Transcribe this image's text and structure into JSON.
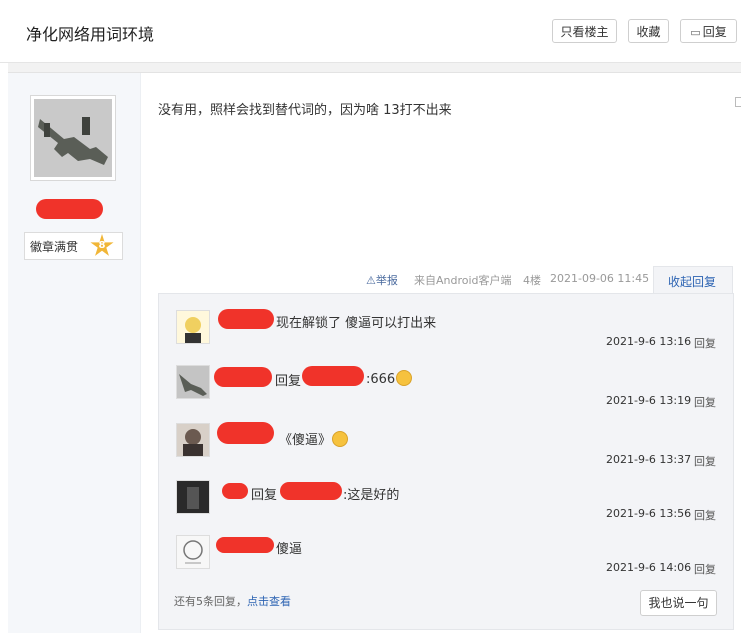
{
  "header": {
    "title": "净化网络用词环境",
    "only_author": "只看楼主",
    "favorite": "收藏",
    "reply": "回复",
    "reply_icon": "speech-bubble-icon"
  },
  "user": {
    "badge_label": "徽章满贯",
    "badge_level": "8"
  },
  "post": {
    "content": "没有用，照样会找到替代词的，因为啥 13打不出来",
    "report": "举报",
    "source": "来自Android客户端",
    "floor": "4楼",
    "datetime": "2021-09-06 11:45",
    "collapse": "收起回复"
  },
  "comments": [
    {
      "text": "现在解锁了 傻逼可以打出来",
      "time": "2021-9-6 13:16",
      "reply": "回复"
    },
    {
      "prefix": "回复",
      "text": ":666",
      "time": "2021-9-6 13:19",
      "reply": "回复"
    },
    {
      "text": "《傻逼》",
      "time": "2021-9-6 13:37",
      "reply": "回复"
    },
    {
      "prefix": "回复",
      "text": ":这是好的",
      "time": "2021-9-6 13:56",
      "reply": "回复"
    },
    {
      "text": "傻逼",
      "time": "2021-9-6 14:06",
      "reply": "回复"
    }
  ],
  "footer": {
    "more_prefix": "还有5条回复，",
    "more_link": "点击查看",
    "say_button": "我也说一句"
  },
  "colors": {
    "link": "#2d64b3",
    "redaction": "#f0332a"
  }
}
